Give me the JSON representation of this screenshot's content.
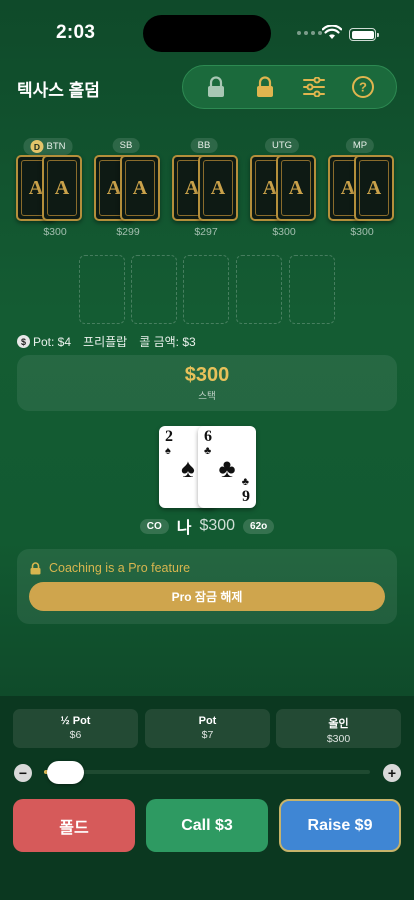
{
  "status": {
    "time": "2:03"
  },
  "header": {
    "title": "텍사스 홀덤",
    "tools": [
      "lock-open-icon",
      "lock-icon",
      "sliders-icon",
      "help-icon"
    ]
  },
  "seats": [
    {
      "position": "BTN",
      "dealer": "D",
      "stack": "$300",
      "card_text": "A"
    },
    {
      "position": "SB",
      "stack": "$299",
      "card_text": "A"
    },
    {
      "position": "BB",
      "stack": "$297",
      "card_text": "A"
    },
    {
      "position": "UTG",
      "stack": "$300",
      "card_text": "A"
    },
    {
      "position": "MP",
      "stack": "$300",
      "card_text": "A"
    }
  ],
  "pot_info": {
    "coin": "$",
    "pot": "Pot: $4",
    "street": "프리플랍",
    "call_amount": "콜 금액: $3"
  },
  "stack_box": {
    "amount": "$300",
    "label": "스택"
  },
  "hero": {
    "cards": [
      {
        "rank": "2",
        "suit": "♠"
      },
      {
        "rank": "6",
        "suit": "♣",
        "bottom_rank": "9"
      }
    ],
    "position": "CO",
    "name": "나",
    "stack": "$300",
    "hand": "62o"
  },
  "coaching": {
    "message": "Coaching is a Pro feature",
    "unlock_label": "Pro 잠금 해제"
  },
  "bet_sizes": [
    {
      "label": "½ Pot",
      "amount": "$6"
    },
    {
      "label": "Pot",
      "amount": "$7"
    },
    {
      "label": "올인",
      "amount": "$300"
    }
  ],
  "slider": {
    "minus": "−",
    "plus": "+",
    "level": 0.02
  },
  "actions": {
    "fold": "폴드",
    "call": "Call $3",
    "raise": "Raise $9"
  },
  "colors": {
    "accent_gold": "#e7c15a",
    "fold": "#d65a5a",
    "call": "#2e9a62",
    "raise": "#3f86d4"
  }
}
